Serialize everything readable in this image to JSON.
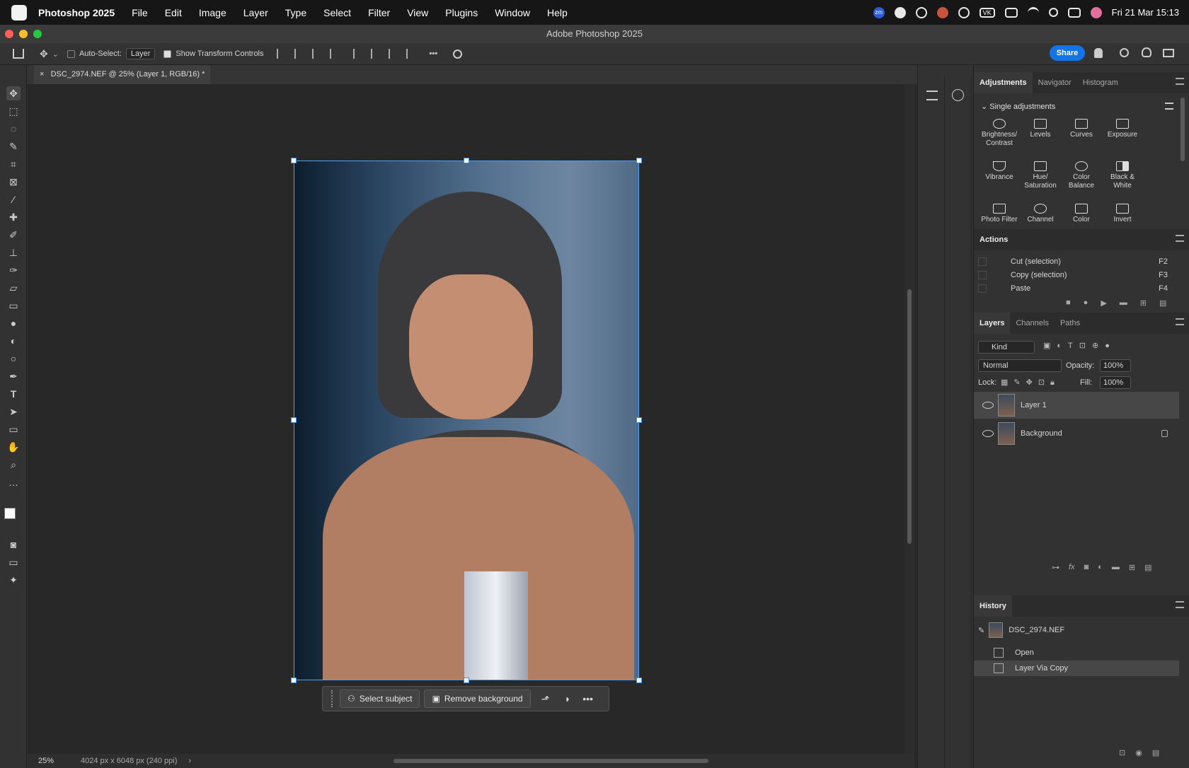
{
  "menubar": {
    "app_name": "Photoshop 2025",
    "items": [
      "File",
      "Edit",
      "Image",
      "Layer",
      "Type",
      "Select",
      "Filter",
      "View",
      "Plugins",
      "Window",
      "Help"
    ],
    "clock": "Fri 21 Mar  15:13",
    "vk_label": "VK",
    "zm_label": "zm"
  },
  "window": {
    "title": "Adobe Photoshop 2025"
  },
  "options": {
    "auto_select_label": "Auto-Select:",
    "auto_select_value": "Layer",
    "show_transform_label": "Show Transform Controls",
    "more_label": "•••",
    "share_label": "Share"
  },
  "document": {
    "tab_close": "×",
    "tab_title": "DSC_2974.NEF @ 25% (Layer 1, RGB/16) *"
  },
  "context_bar": {
    "select_subject": "Select subject",
    "remove_background": "Remove background",
    "more": "•••"
  },
  "status": {
    "zoom": "25%",
    "info": "4024 px x 6048 px (240 ppi)",
    "arrow": "›"
  },
  "adjustments": {
    "tabs": [
      "Adjustments",
      "Navigator",
      "Histogram"
    ],
    "section": "Single adjustments",
    "items": [
      {
        "label": "Brightness/ Contrast",
        "icon": "sun-icon"
      },
      {
        "label": "Levels",
        "icon": "levels-icon"
      },
      {
        "label": "Curves",
        "icon": "curves-icon"
      },
      {
        "label": "Exposure",
        "icon": "exposure-icon"
      },
      {
        "label": "Vibrance",
        "icon": "vibrance-icon"
      },
      {
        "label": "Hue/ Saturation",
        "icon": "hue-saturation-icon"
      },
      {
        "label": "Color Balance",
        "icon": "color-balance-icon"
      },
      {
        "label": "Black & White",
        "icon": "black-white-icon"
      },
      {
        "label": "Photo Filter",
        "icon": "camera-icon"
      },
      {
        "label": "Channel",
        "icon": "channel-icon"
      },
      {
        "label": "Color",
        "icon": "grid-icon"
      },
      {
        "label": "Invert",
        "icon": "invert-icon"
      }
    ]
  },
  "actions": {
    "title": "Actions",
    "items": [
      {
        "name": "Cut (selection)",
        "key": "F2"
      },
      {
        "name": "Copy (selection)",
        "key": "F3"
      },
      {
        "name": "Paste",
        "key": "F4"
      }
    ]
  },
  "layers": {
    "tabs": [
      "Layers",
      "Channels",
      "Paths"
    ],
    "filter_kind": "Kind",
    "blend_mode": "Normal",
    "opacity_label": "Opacity:",
    "opacity_value": "100%",
    "lock_label": "Lock:",
    "fill_label": "Fill:",
    "fill_value": "100%",
    "items": [
      {
        "name": "Layer 1",
        "selected": true
      },
      {
        "name": "Background",
        "locked": true
      }
    ]
  },
  "history": {
    "title": "History",
    "snapshot": "DSC_2974.NEF",
    "items": [
      "Open",
      "Layer Via Copy"
    ]
  },
  "colors": {
    "accent": "#1473e6",
    "selection": "#4aa3ff"
  }
}
